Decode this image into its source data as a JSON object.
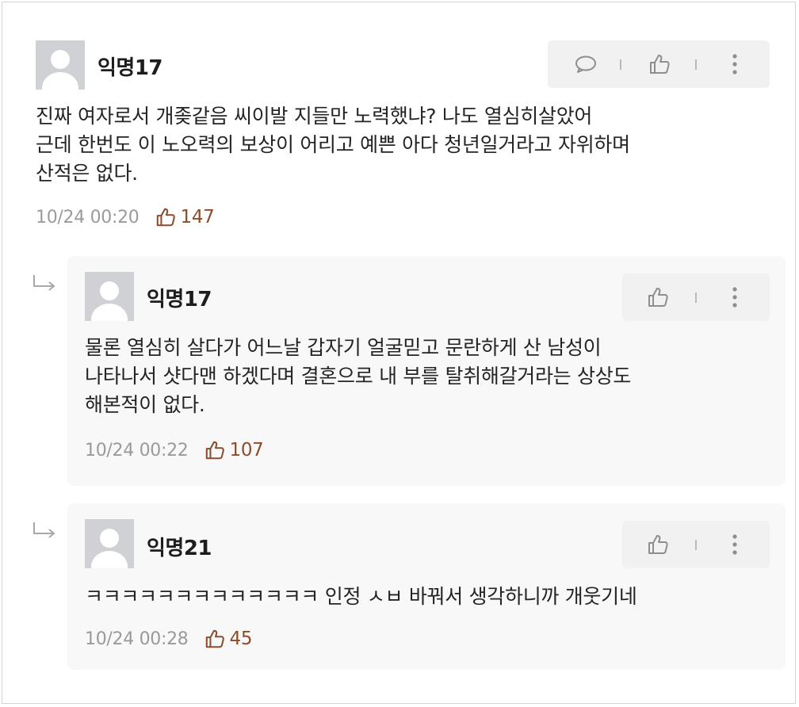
{
  "comments": [
    {
      "author": "익명17",
      "body": [
        "진짜 여자로서 개좆같음 씨이발 지들만 노력했냐? 나도 열심히살았어",
        "근데 한번도 이 노오력의 보상이 어리고 예쁜 아다 청년일거라고 자위하며",
        "산적은 없다."
      ],
      "time": "10/24 00:20",
      "likes": "147"
    }
  ],
  "replies": [
    {
      "author": "익명17",
      "body": [
        "물론 열심히 살다가 어느날 갑자기 얼굴믿고 문란하게 산 남성이",
        "나타나서 샷다맨 하겠다며 결혼으로 내 부를 탈취해갈거라는 상상도",
        "해본적이 없다."
      ],
      "time": "10/24 00:22",
      "likes": "107"
    },
    {
      "author": "익명21",
      "body": [
        "ㅋㅋㅋㅋㅋㅋㅋㅋㅋㅋㅋㅋㅋ 인정 ㅅㅂ 바꿔서 생각하니까 개웃기네"
      ],
      "time": "10/24 00:28",
      "likes": "45"
    }
  ],
  "icons": {
    "reply": "speech-bubble-icon",
    "like": "thumbs-up-icon",
    "more": "more-vertical-icon",
    "reply_indicator": "reply-arrow-icon"
  },
  "colors": {
    "like_count": "#8a4e2c",
    "meta_text": "#9a9a9a",
    "reply_bg": "#f8f8f8",
    "action_bg": "#f1f1f1"
  }
}
